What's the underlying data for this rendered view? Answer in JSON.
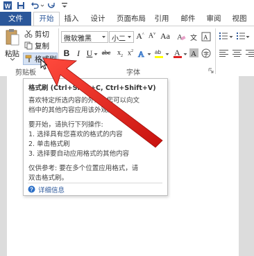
{
  "ribbon_tabs": [
    "文件",
    "开始",
    "插入",
    "设计",
    "页面布局",
    "引用",
    "邮件",
    "审阅",
    "视图"
  ],
  "clipboard": {
    "paste_label": "粘贴",
    "cut_label": "剪切",
    "copy_label": "复制",
    "format_painter_label": "格式刷",
    "group_label": "剪贴板"
  },
  "font": {
    "font_name": "微软雅黑",
    "font_size": "小二",
    "group_label": "字体"
  },
  "tooltip": {
    "title": "格式刷 (Ctrl+Shift+C, Ctrl+Shift+V)",
    "desc_line1": "喜欢特定所选内容的外观? 您可以向文",
    "desc_line2": "档中的其他内容应用该外观。",
    "start_line": "要开始，请执行下列操作:",
    "step1": "1. 选择具有您喜欢的格式的内容",
    "step2": "2. 单击格式刷",
    "step3": "3. 选择要自动应用格式的其他内容",
    "ref_line1": "仅供参考: 要在多个位置应用格式，请",
    "ref_line2": "双击格式刷。",
    "more_info": "详细信息"
  },
  "colors": {
    "file_tab": "#2b579a",
    "accent": "#2b579a",
    "arrow": "#e8231f",
    "font_color": "#e02020",
    "highlight": "#ffff00"
  }
}
